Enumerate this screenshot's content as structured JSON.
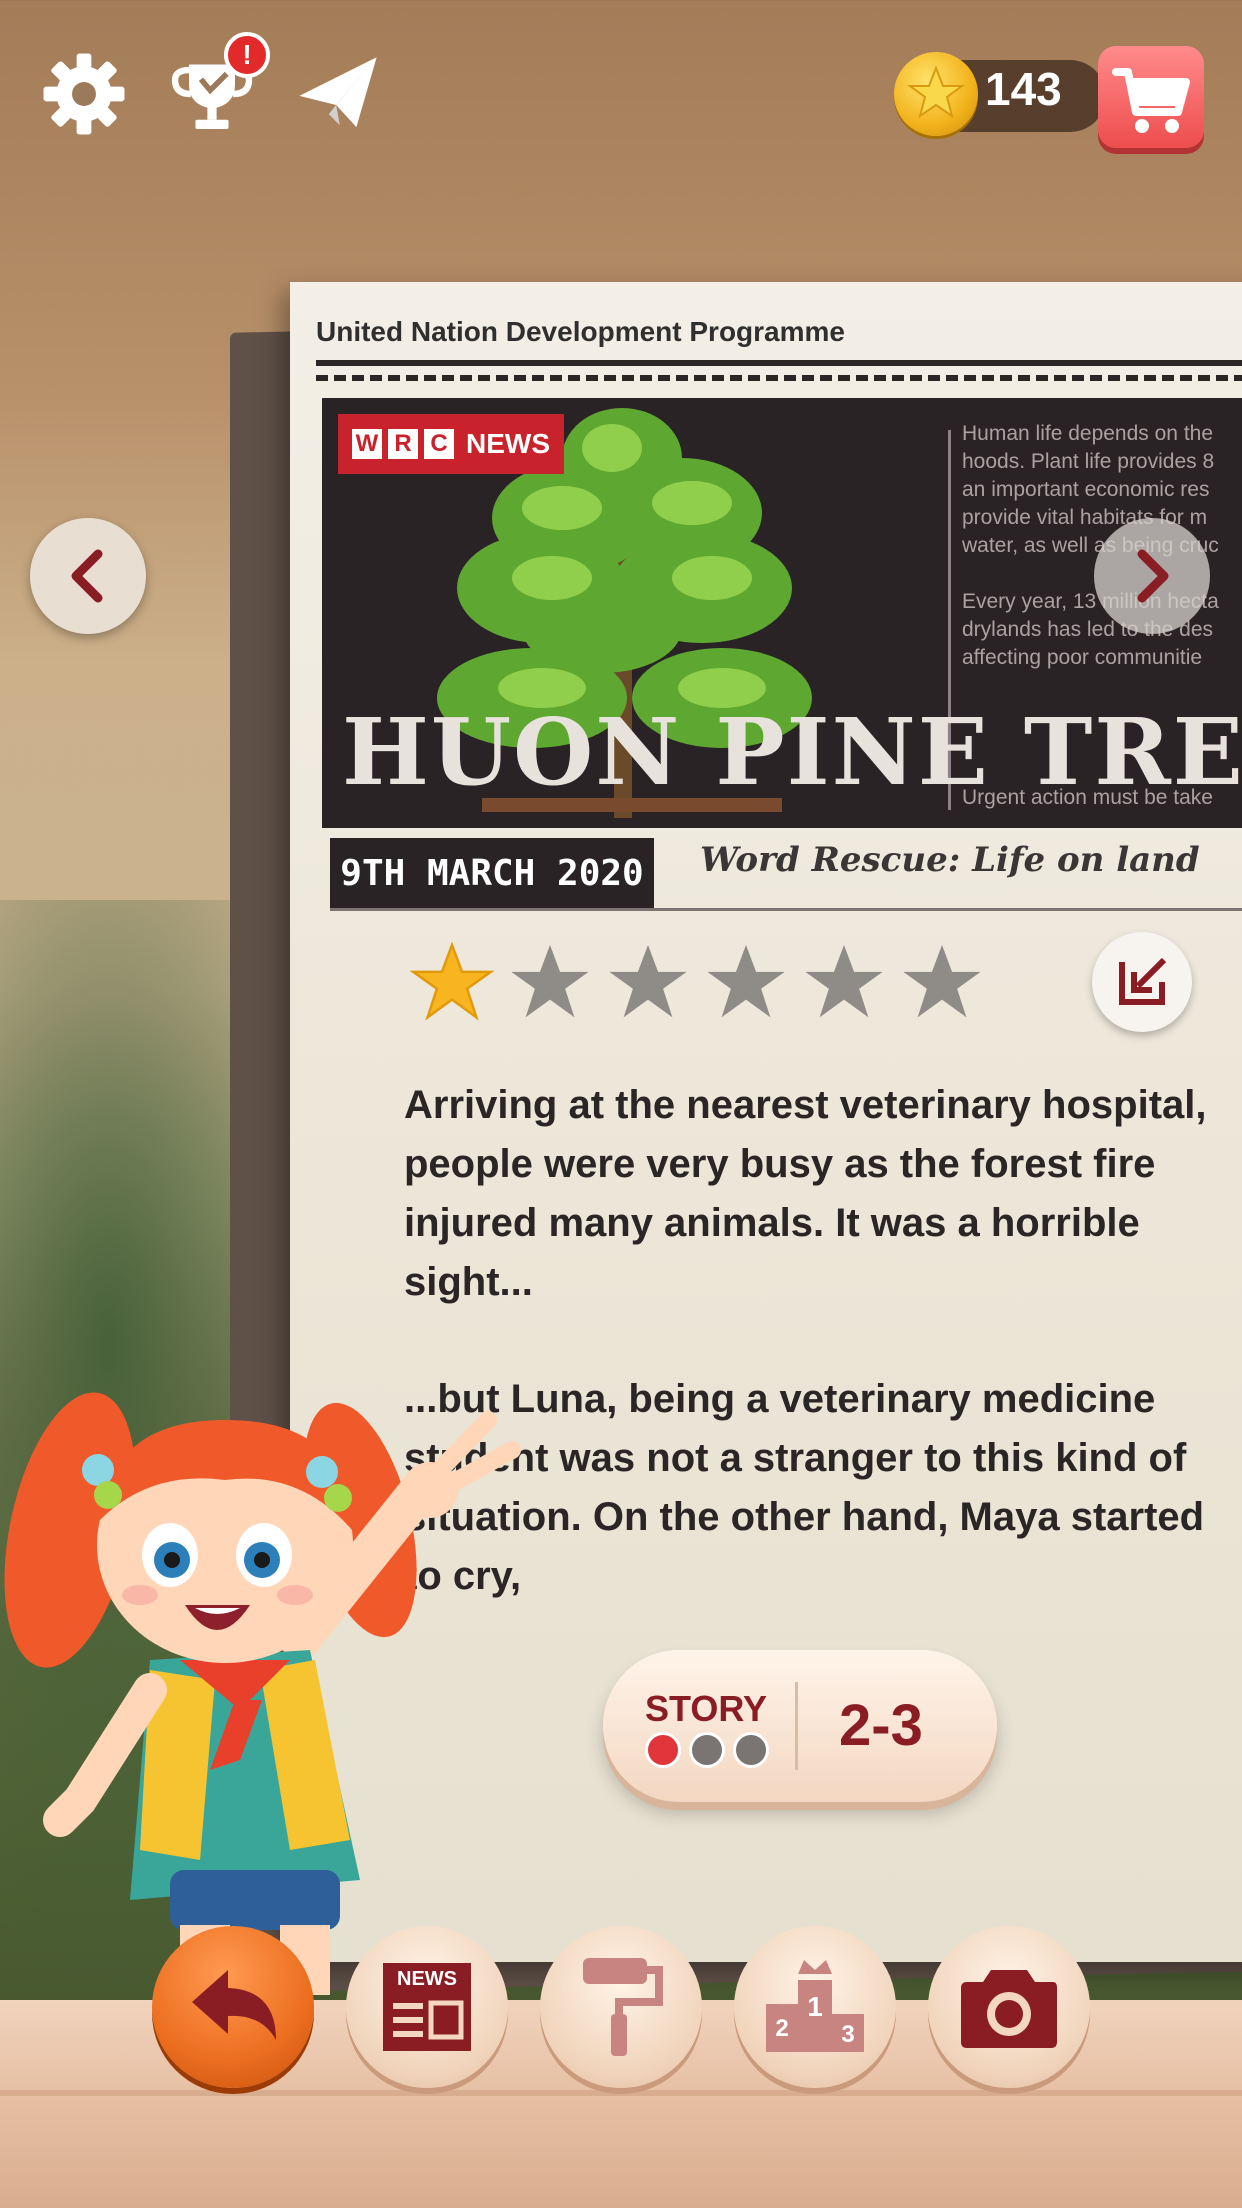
{
  "topbar": {
    "settings_icon": "gear-icon",
    "achievements_icon": "trophy-icon",
    "achievements_badge": "!",
    "share_icon": "paper-plane-icon",
    "coin_icon": "star-coin-icon",
    "coins": "143",
    "shop_icon": "cart-icon"
  },
  "newspaper": {
    "publisher": "United Nation Development Programme",
    "logo_letters": [
      "W",
      "R",
      "C"
    ],
    "logo_word": "NEWS",
    "headline": "HUON PINE TREE",
    "column_text": [
      "Human life depends on the",
      "hoods. Plant life provides 8",
      "an important economic res",
      "provide vital habitats for m",
      "water, as well as being cruc",
      "",
      "Every year, 13 million hecta",
      "drylands has led to the des",
      "affecting poor communitie",
      "",
      "",
      "Urgent action must be take"
    ],
    "date": "9TH MARCH  2020",
    "theme": "Word Rescue: Life on land"
  },
  "rating": {
    "filled": 1,
    "total": 6,
    "filled_color": "#f9b51f",
    "empty_color": "#8f8b86"
  },
  "story": {
    "paragraphs": [
      "Arriving at the nearest veterinary hospital, people were very busy as the forest fire injured many animals. It was a horrible sight...",
      "...but Luna, being a veterinary medicine student was not a stranger to this kind of situation. On the other hand, Maya started to cry,"
    ],
    "label": "STORY",
    "level": "2-3",
    "progress_dots": [
      "#e0353b",
      "#7a7472",
      "#7a7472"
    ]
  },
  "bottom_bar": {
    "back_icon": "undo-arrow-icon",
    "news_label": "NEWS",
    "paint_icon": "paint-roller-icon",
    "ranking_numbers": [
      "1",
      "2",
      "3"
    ],
    "camera_icon": "camera-icon"
  },
  "colors": {
    "accent": "#8a1c24",
    "cart": "#ee4d4d",
    "back_button": "#ec6e1f"
  }
}
